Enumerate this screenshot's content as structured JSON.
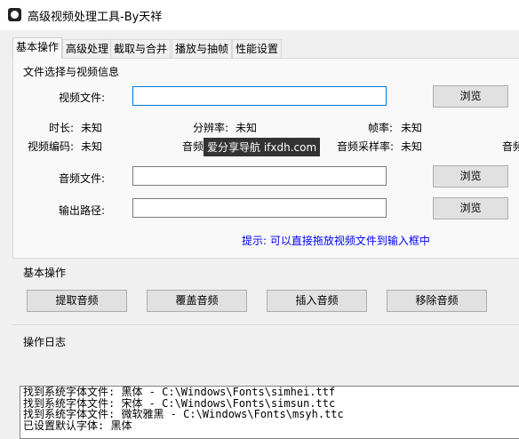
{
  "window": {
    "title": "高级视频处理工具-By天祥"
  },
  "tabs": [
    "基本操作",
    "高级处理",
    "截取与合并",
    "播放与抽帧",
    "性能设置"
  ],
  "file_group": {
    "title": "文件选择与视频信息",
    "video_label": "视频文件:",
    "video_value": "",
    "browse1": "浏览",
    "duration_label": "时长:",
    "duration_value": "未知",
    "resolution_label": "分辨率:",
    "resolution_value": "未知",
    "fps_label": "帧率:",
    "fps_value": "未知",
    "vcodec_label": "视频编码:",
    "vcodec_value": "未知",
    "acodec_label_partial": "音频",
    "samplerate_label": "音频采样率:",
    "samplerate_value": "未知",
    "cut_label": "音频",
    "audio_label": "音频文件:",
    "audio_value": "",
    "browse2": "浏览",
    "output_label": "输出路径:",
    "output_value": "",
    "browse3": "浏览",
    "hint": "提示: 可以直接拖放视频文件到输入框中"
  },
  "watermark": "爱分享导航 ifxdh.com",
  "basic_ops": {
    "title": "基本操作",
    "buttons": [
      "提取音频",
      "覆盖音频",
      "插入音频",
      "移除音频"
    ]
  },
  "log": {
    "title": "操作日志",
    "lines": [
      "找到系统字体文件: 黑体 - C:\\Windows\\Fonts\\simhei.ttf",
      "找到系统字体文件: 宋体 - C:\\Windows\\Fonts\\simsun.ttc",
      "找到系统字体文件: 微软雅黑 - C:\\Windows\\Fonts\\msyh.ttc",
      "已设置默认字体: 黑体"
    ]
  }
}
